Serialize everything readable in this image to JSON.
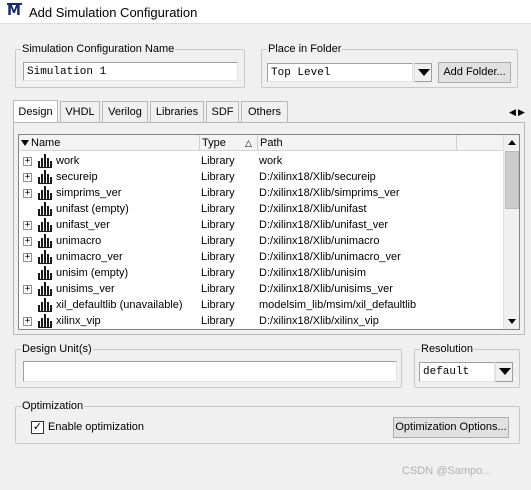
{
  "window": {
    "title": "Add Simulation Configuration",
    "app_icon": "M"
  },
  "config_name": {
    "label": "Simulation Configuration Name",
    "value": "Simulation 1"
  },
  "place_in_folder": {
    "label": "Place in Folder",
    "value": "Top Level",
    "add_folder_label": "Add Folder..."
  },
  "tabs": [
    "Design",
    "VHDL",
    "Verilog",
    "Libraries",
    "SDF",
    "Others"
  ],
  "tab_scroll": {
    "left": "◀",
    "right": "▶"
  },
  "table": {
    "columns": {
      "name": "Name",
      "type": "Type",
      "sort_glyph": "△",
      "path": "Path"
    },
    "rows": [
      {
        "expand": "+",
        "name": "work",
        "type": "Library",
        "path": "work"
      },
      {
        "expand": "+",
        "name": "secureip",
        "type": "Library",
        "path": "D:/xilinx18/Xlib/secureip"
      },
      {
        "expand": "+",
        "name": "simprims_ver",
        "type": "Library",
        "path": "D:/xilinx18/Xlib/simprims_ver"
      },
      {
        "expand": "",
        "name": "unifast  (empty)",
        "type": "Library",
        "path": "D:/xilinx18/Xlib/unifast"
      },
      {
        "expand": "+",
        "name": "unifast_ver",
        "type": "Library",
        "path": "D:/xilinx18/Xlib/unifast_ver"
      },
      {
        "expand": "+",
        "name": "unimacro",
        "type": "Library",
        "path": "D:/xilinx18/Xlib/unimacro"
      },
      {
        "expand": "+",
        "name": "unimacro_ver",
        "type": "Library",
        "path": "D:/xilinx18/Xlib/unimacro_ver"
      },
      {
        "expand": "",
        "name": "unisim  (empty)",
        "type": "Library",
        "path": "D:/xilinx18/Xlib/unisim"
      },
      {
        "expand": "+",
        "name": "unisims_ver",
        "type": "Library",
        "path": "D:/xilinx18/Xlib/unisims_ver"
      },
      {
        "expand": "",
        "name": "xil_defaultlib  (unavailable)",
        "type": "Library",
        "path": "modelsim_lib/msim/xil_defaultlib"
      },
      {
        "expand": "+",
        "name": "xilinx_vip",
        "type": "Library",
        "path": "D:/xilinx18/Xlib/xilinx_vip"
      }
    ]
  },
  "design_unit": {
    "label": "Design Unit(s)",
    "value": ""
  },
  "resolution": {
    "label": "Resolution",
    "value": "default"
  },
  "optimization": {
    "label": "Optimization",
    "checkbox_label": "Enable optimization",
    "checked_glyph": "✓",
    "options_button": "Optimization Options..."
  },
  "footer": {
    "watermark": "CSDN @Sampo..."
  }
}
